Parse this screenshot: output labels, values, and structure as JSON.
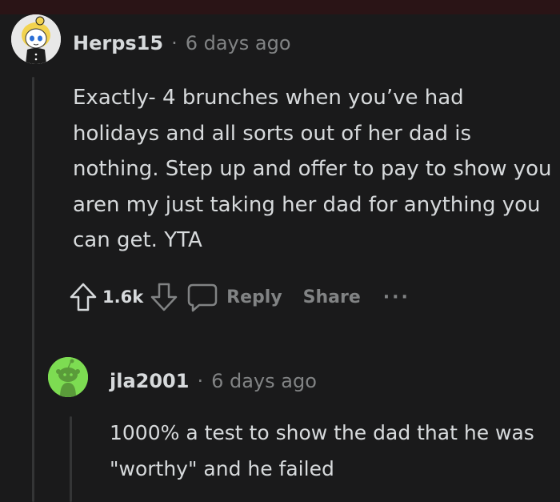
{
  "comment": {
    "username": "Herps15",
    "separator": "·",
    "timestamp": "6 days ago",
    "body": "Exactly- 4 brunches when you’ve had holidays and all sorts out of her dad is nothing. Step up and offer to pay to show you aren my just taking her dad for anything you can get. YTA",
    "votes": "1.6k",
    "actions": {
      "reply_label": "Reply",
      "share_label": "Share",
      "more_label": "···"
    },
    "icons": [
      "upvote-icon",
      "downvote-icon",
      "comment-icon",
      "more-icon"
    ]
  },
  "reply": {
    "username": "jla2001",
    "separator": "·",
    "timestamp": "6 days ago",
    "body": "1000% a test to show the dad that he was \"worthy\" and he failed"
  },
  "colors": {
    "background": "#1a1a1b",
    "text": "#d7dadc",
    "muted": "#818384",
    "thread_line": "#343536",
    "avatar_green": "#7ddc52"
  }
}
